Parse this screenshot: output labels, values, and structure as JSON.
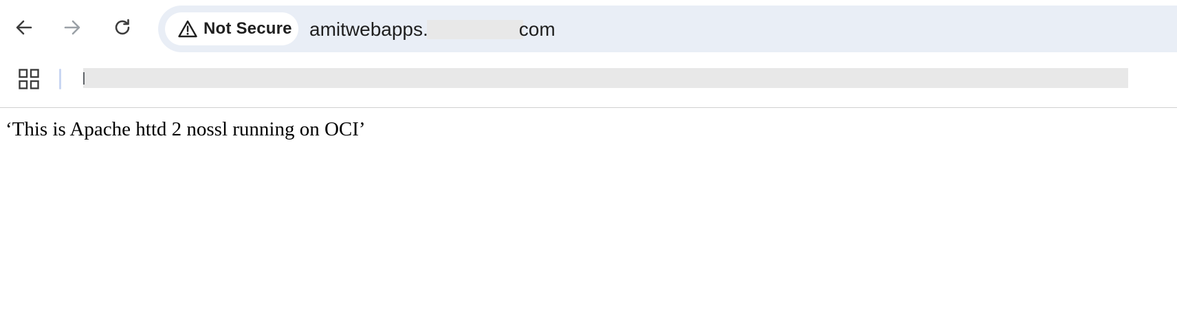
{
  "browser": {
    "nav": {
      "back_icon": "arrow-left-icon",
      "forward_icon": "arrow-right-icon",
      "reload_icon": "reload-icon"
    },
    "omnibox": {
      "security_label": "Not Secure",
      "security_icon": "warning-triangle-icon",
      "url_prefix": "amitwebapps.",
      "url_suffix": "com"
    },
    "bookmarks_bar": {
      "apps_icon": "apps-grid-icon"
    }
  },
  "page": {
    "body_text": "‘This is Apache httd 2 nossl running on OCI’"
  },
  "colors": {
    "omnibox_bg": "#e9eef6",
    "text": "#1f1f1f",
    "disabled_icon": "#9aa0a6",
    "redaction": "#e8e8e8"
  }
}
